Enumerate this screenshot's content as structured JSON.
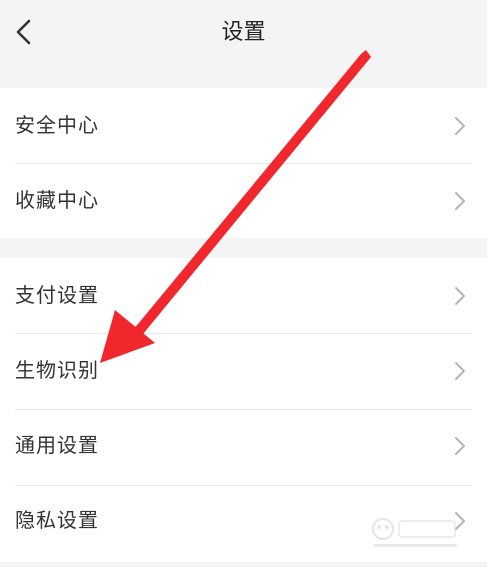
{
  "header": {
    "title": "设置"
  },
  "groups": [
    {
      "items": [
        {
          "label": "安全中心"
        },
        {
          "label": "收藏中心"
        }
      ]
    },
    {
      "items": [
        {
          "label": "支付设置"
        },
        {
          "label": "生物识别"
        },
        {
          "label": "通用设置"
        },
        {
          "label": "隐私设置"
        }
      ]
    }
  ],
  "colors": {
    "background": "#f4f4f4",
    "card": "#ffffff",
    "text": "#333333",
    "chevron": "#b5b5b5",
    "annotation_arrow": "#f0282d"
  },
  "icons": {
    "back": "chevron-left-icon",
    "row_action": "chevron-right-icon"
  }
}
